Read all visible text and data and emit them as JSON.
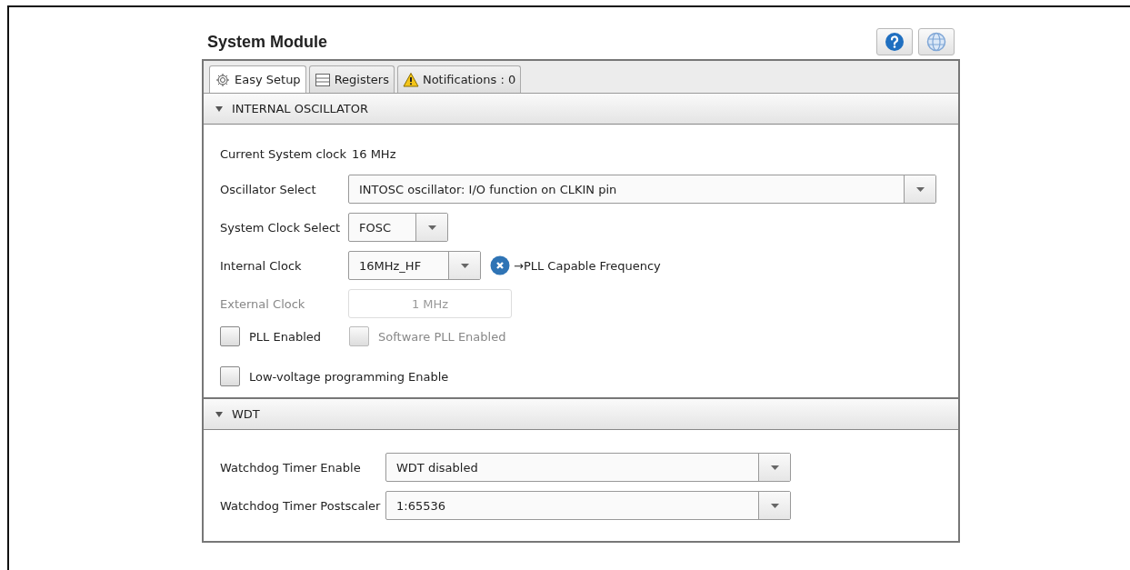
{
  "title": "System Module",
  "tabs": [
    {
      "label": "Easy Setup",
      "selected": true
    },
    {
      "label": "Registers",
      "selected": false
    },
    {
      "label": "Notifications : 0",
      "selected": false
    }
  ],
  "sections": [
    {
      "title": "INTERNAL OSCILLATOR",
      "expanded": true,
      "rows": [
        {
          "kind": "readout",
          "label": "Current System clock",
          "value": "16 MHz"
        },
        {
          "kind": "select",
          "label": "Oscillator Select",
          "value": "INTOSC oscillator: I/O function on CLKIN pin"
        },
        {
          "kind": "select",
          "label": "System Clock Select",
          "value": "FOSC"
        },
        {
          "kind": "select",
          "label": "Internal Clock",
          "value": "16MHz_HF",
          "note": "→PLL Capable Frequency"
        },
        {
          "kind": "text",
          "label": "External Clock",
          "value": "1 MHz",
          "disabled": true
        },
        {
          "kind": "checks",
          "items": [
            {
              "label": "PLL Enabled",
              "checked": false,
              "disabled": false
            },
            {
              "label": "Software PLL Enabled",
              "checked": false,
              "disabled": true
            }
          ]
        },
        {
          "kind": "checks",
          "items": [
            {
              "label": "Low-voltage programming Enable",
              "checked": false,
              "disabled": false
            }
          ]
        }
      ]
    },
    {
      "title": "WDT",
      "expanded": true,
      "rows": [
        {
          "kind": "select",
          "label": "Watchdog Timer Enable",
          "value": "WDT disabled"
        },
        {
          "kind": "select",
          "label": "Watchdog Timer Postscaler",
          "value": "1:65536"
        }
      ]
    }
  ]
}
